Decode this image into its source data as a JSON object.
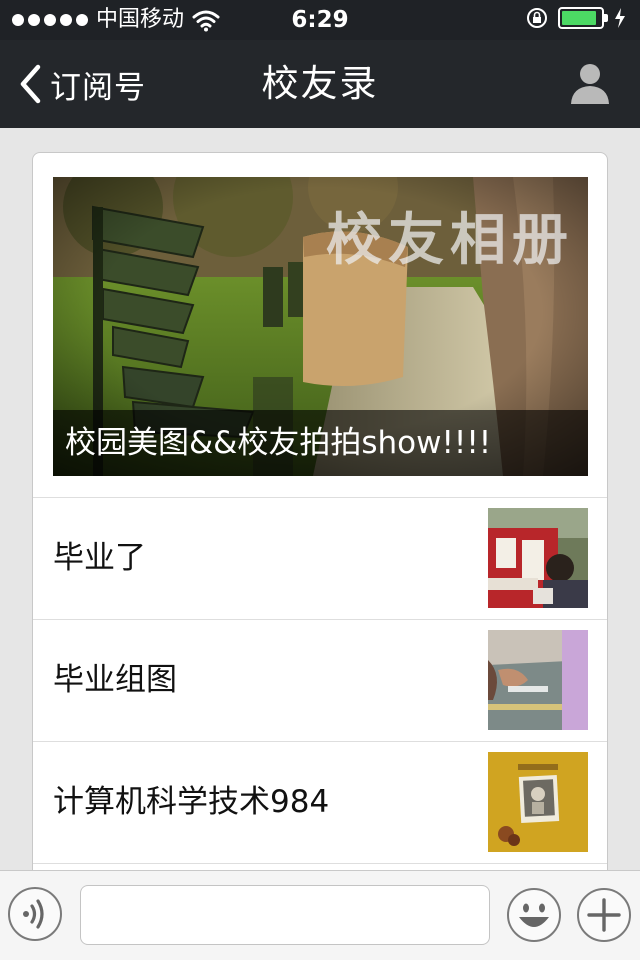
{
  "status_bar": {
    "carrier": "中国移动",
    "time": "6:29",
    "battery_level": 0.9,
    "colors": {
      "battery": "#4cd964"
    }
  },
  "nav": {
    "back_label": "订阅号",
    "title": "校友录"
  },
  "feature": {
    "watermark": "校友相册",
    "caption": "校园美图&&校友拍拍show!!!!"
  },
  "articles": [
    {
      "title": "毕业了"
    },
    {
      "title": "毕业组图"
    },
    {
      "title": "计算机科学技术984"
    }
  ],
  "input": {
    "placeholder": ""
  },
  "icons": [
    "back-chevron-icon",
    "profile-icon",
    "voice-icon",
    "emoji-icon",
    "plus-icon",
    "wifi-icon",
    "rotation-lock-icon",
    "battery-icon"
  ]
}
